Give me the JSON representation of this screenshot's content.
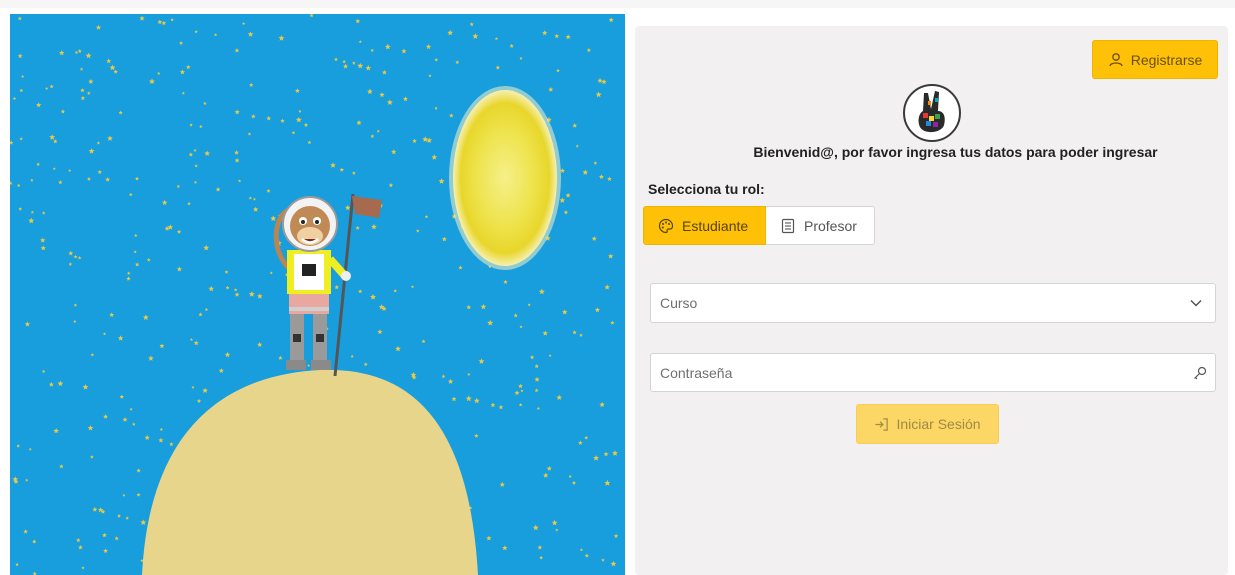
{
  "header": {
    "register_label": "Registrarse"
  },
  "welcome_text": "Bienvenid@, por favor ingresa tus datos para poder ingresar",
  "role": {
    "label": "Selecciona tu rol:",
    "options": [
      {
        "label": "Estudiante",
        "icon": "palette-icon",
        "selected": true
      },
      {
        "label": "Profesor",
        "icon": "document-icon",
        "selected": false
      }
    ]
  },
  "form": {
    "course": {
      "placeholder": "Curso"
    },
    "password": {
      "placeholder": "Contraseña"
    },
    "submit_label": "Iniciar Sesión"
  },
  "colors": {
    "accent": "#fec107",
    "accent_disabled": "#fcd766",
    "sky": "#189ddd",
    "panel": "#f2f0f1"
  }
}
